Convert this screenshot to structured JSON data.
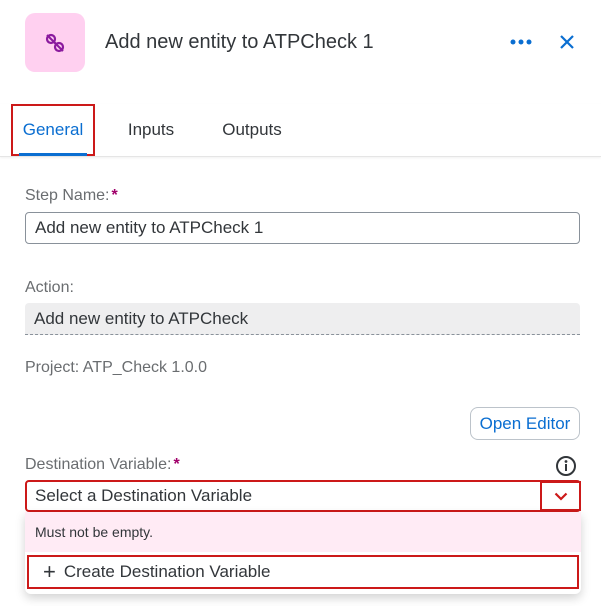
{
  "header": {
    "title": "Add new entity to ATPCheck 1",
    "icon": "entity-link-icon",
    "more_icon": "more-options-icon",
    "close_icon": "close-icon"
  },
  "tabs": [
    {
      "label": "General",
      "active": true
    },
    {
      "label": "Inputs",
      "active": false
    },
    {
      "label": "Outputs",
      "active": false
    }
  ],
  "form": {
    "step_name_label": "Step Name:",
    "step_name_value": "Add new entity to ATPCheck 1",
    "action_label": "Action:",
    "action_value": "Add new entity to ATPCheck",
    "project_text": "Project: ATP_Check 1.0.0",
    "open_editor_label": "Open Editor",
    "destination_label": "Destination Variable:",
    "destination_placeholder": "Select a Destination Variable",
    "required_mark": "*",
    "error_text": "Must not be empty.",
    "create_label": "Create Destination Variable",
    "create_icon": "plus-icon"
  },
  "colors": {
    "accent": "#0a6ed1",
    "required": "#a0006a",
    "highlight": "#cc1919",
    "icon_bg": "#ffd0f0",
    "error_bg": "#ffebf5"
  }
}
